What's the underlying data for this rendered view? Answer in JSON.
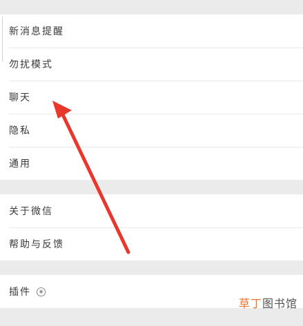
{
  "settings": {
    "group1": [
      {
        "label": "新消息提醒"
      },
      {
        "label": "勿扰模式"
      },
      {
        "label": "聊天"
      },
      {
        "label": "隐私"
      },
      {
        "label": "通用"
      }
    ],
    "group2": [
      {
        "label": "关于微信"
      },
      {
        "label": "帮助与反馈"
      }
    ],
    "group3": [
      {
        "label": "插件"
      }
    ]
  },
  "overlay": {
    "arrow_color": "#e8382e"
  },
  "watermark": {
    "accent": "草丁",
    "rest": "图书馆"
  }
}
